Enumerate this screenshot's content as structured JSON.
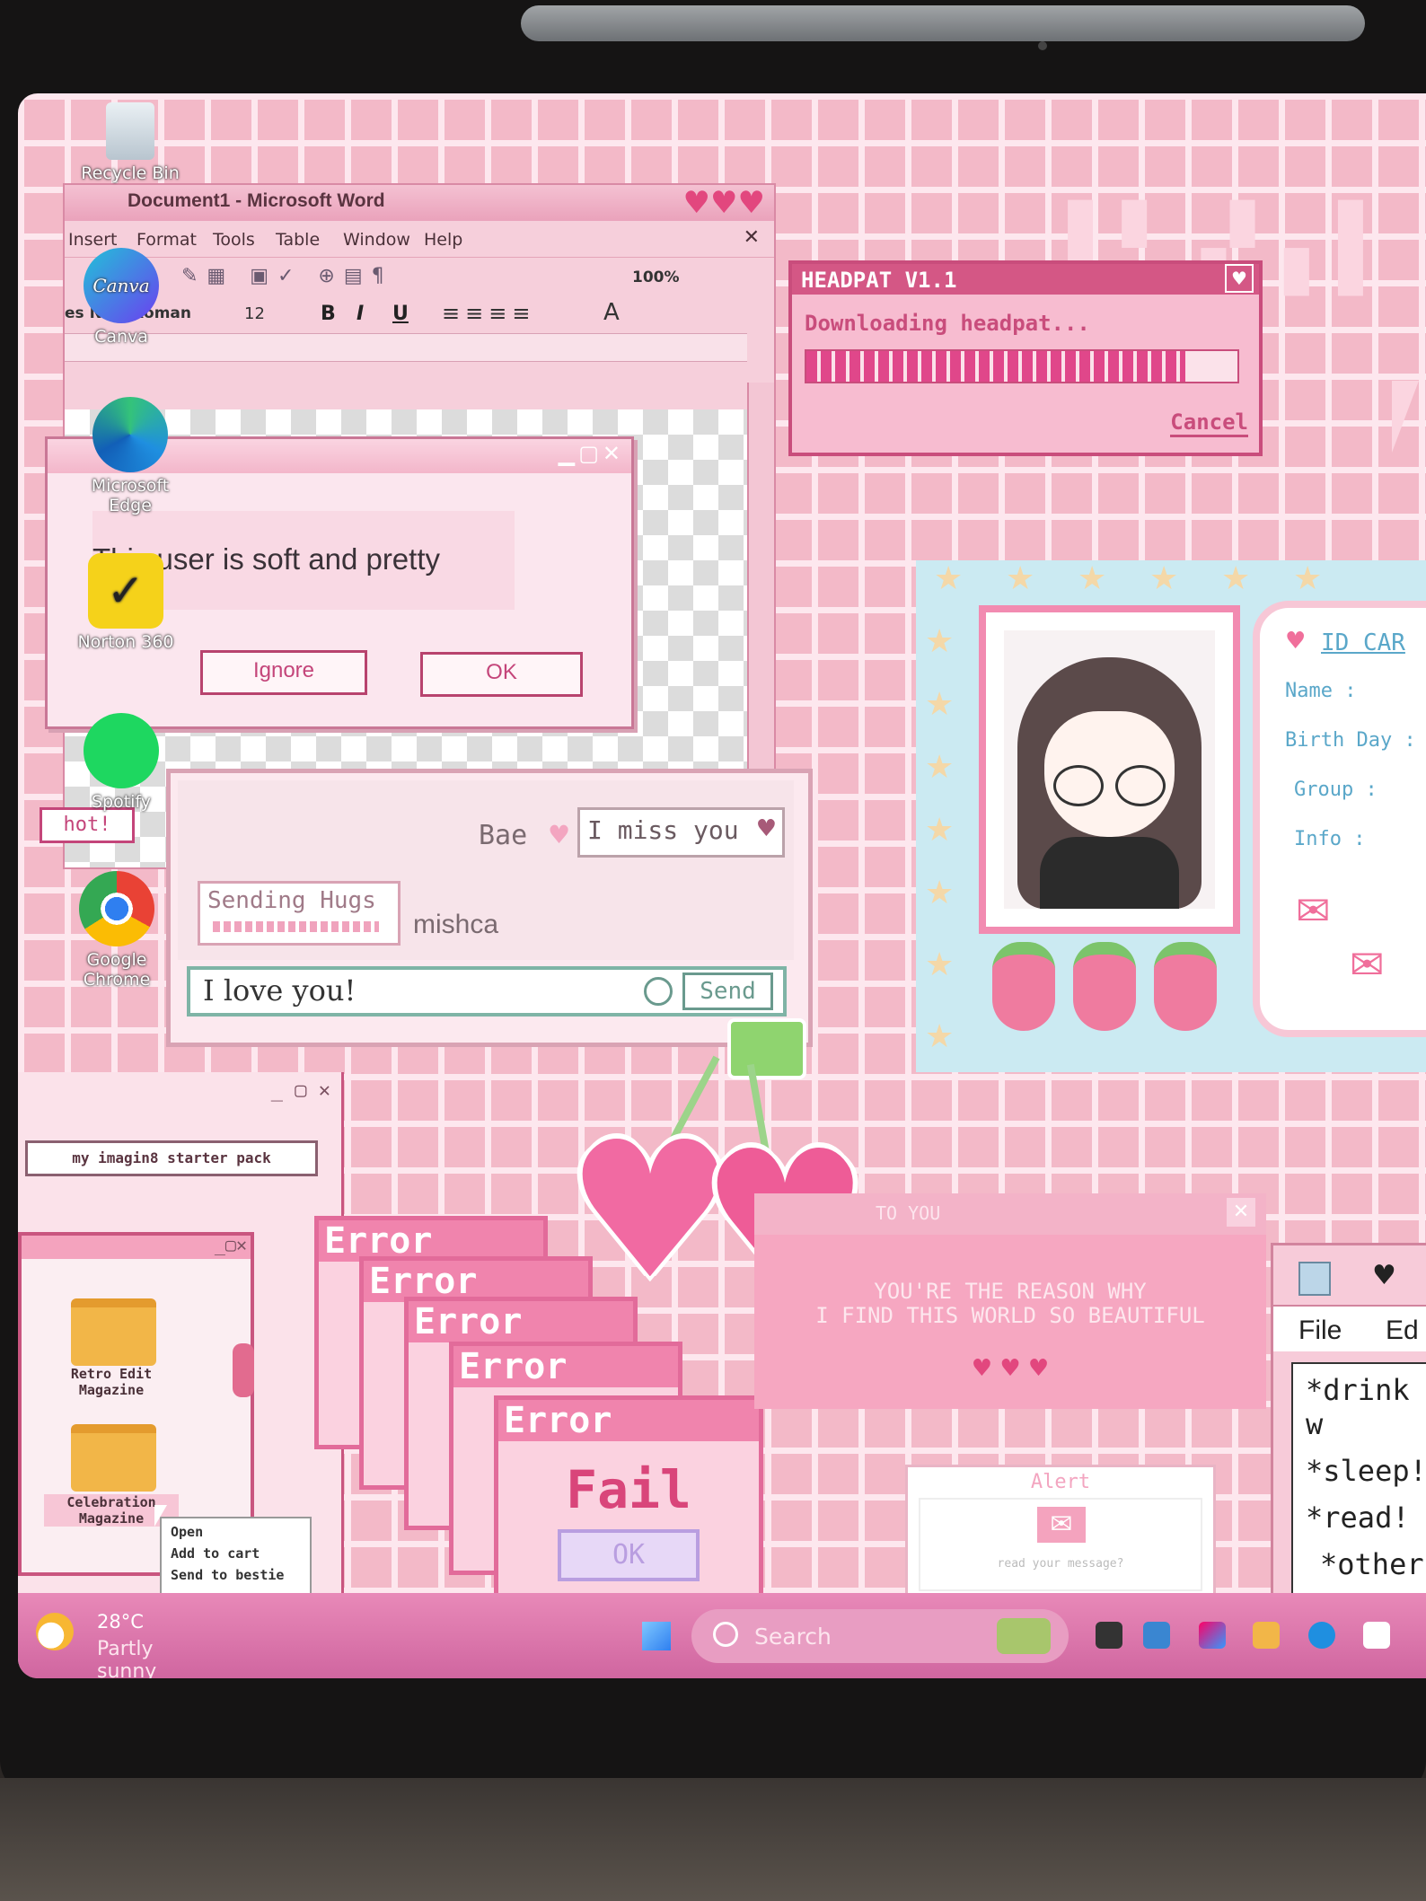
{
  "desktop_icons": {
    "recycle_bin": "Recycle Bin",
    "canva": "Canva",
    "canva_logo": "Canva",
    "edge": "Microsoft Edge",
    "norton": "Norton 360",
    "spotify": "Spotify",
    "chrome": "Google Chrome"
  },
  "word": {
    "title": "Document1 - Microsoft Word",
    "menu": [
      "Insert",
      "Format",
      "Tools",
      "Table",
      "Window",
      "Help"
    ],
    "zoom": "100%",
    "font_name": "es New Roman",
    "font_size": "12",
    "bold": "B",
    "italic": "I",
    "underline": "U"
  },
  "dialog": {
    "message": "This user is soft and pretty",
    "ignore_label": "Ignore",
    "ok_label": "OK"
  },
  "headpat": {
    "title": "HEADPAT V1.1",
    "status": "Downloading headpat...",
    "progress": 0.88,
    "cancel_label": "Cancel"
  },
  "chat": {
    "sender": "Bae",
    "bubble_in": "I miss you",
    "bubble_out": "Sending Hugs",
    "user": "mishca",
    "input_value": "I love you!",
    "send_label": "Send",
    "side_tag": "hot!"
  },
  "id_card": {
    "title": "ID CAR",
    "fields": [
      "Name :",
      "Birth Day :",
      "Group :",
      "Info :"
    ]
  },
  "starter_pack": {
    "label": "my imagin8 starter pack",
    "folders": [
      "Retro Edit Magazine",
      "Celebration Magazine"
    ],
    "context_menu": [
      "Open",
      "Add to cart",
      "Send to bestie"
    ]
  },
  "error_stack": {
    "title": "Error",
    "fail": "Fail",
    "ok": "OK"
  },
  "love_window": {
    "title": "TO YOU",
    "line1": "YOU'RE THE REASON WHY",
    "line2": "I FIND THIS WORLD SO BEAUTIFUL",
    "hearts": "♥ ♥ ♥"
  },
  "alert": {
    "title": "Alert",
    "text": "read your message?"
  },
  "notes": {
    "menu": [
      "File",
      "Ed"
    ],
    "lines": [
      "*drink w",
      "*sleep!",
      "*read!",
      "*other"
    ]
  },
  "taskbar": {
    "temperature": "28°C",
    "weather": "Partly sunny",
    "search_placeholder": "Search"
  },
  "colors": {
    "accent": "#d44f7f",
    "grid_pink": "#f3b9c8",
    "taskbar": "#d066a0"
  }
}
